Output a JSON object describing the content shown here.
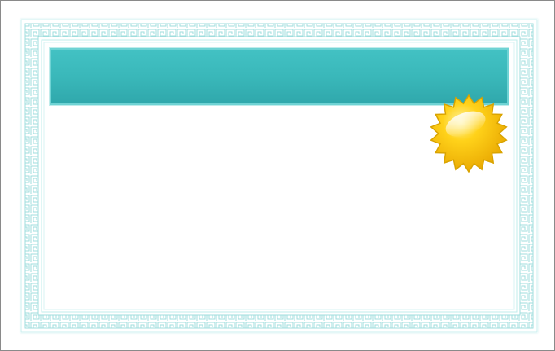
{
  "certificate": {
    "title": "",
    "body_text": ""
  },
  "colors": {
    "banner_top": "#43c2c4",
    "banner_bottom": "#2fa7ab",
    "border_pattern": "#8fd9d9",
    "seal_fill": "#f5c400",
    "seal_stroke": "#d9a300"
  },
  "icons": {
    "seal": "gold-starburst-seal-icon"
  }
}
